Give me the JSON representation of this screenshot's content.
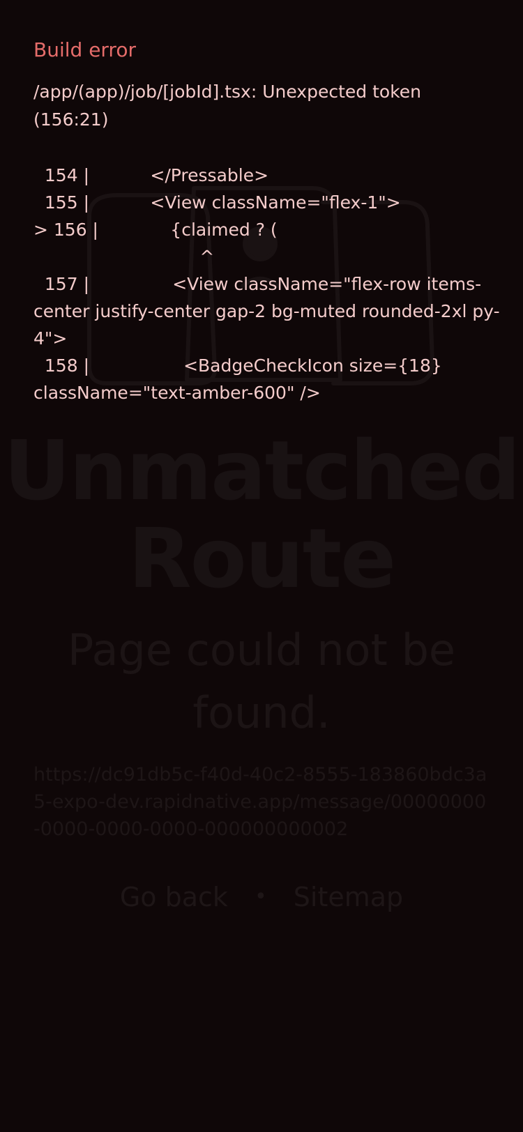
{
  "background": {
    "title": "Unmatched Route",
    "subtitle": "Page could not be found.",
    "url": "https://dc91db5c-f40d-40c2-8555-183860bdc3a5-expo-dev.rapidnative.app/message/00000000-0000-0000-0000-000000000002",
    "links": {
      "go_back": "Go back",
      "separator": "•",
      "sitemap": "Sitemap"
    },
    "icon": "route-illustration-icon"
  },
  "error": {
    "title": "Build error",
    "message": "/app/(app)/job/[jobId].tsx: Unexpected token (156:21)",
    "code_frame": [
      "  154 |           </Pressable>",
      "  155 |           <View className=\"flex-1\">",
      "> 156 |             {claimed ? (",
      "                              ^",
      "  157 |               <View className=\"flex-row items-center justify-center gap-2 bg-muted rounded-2xl py-4\">",
      "  158 |                 <BadgeCheckIcon size={18} className=\"text-amber-600\" />"
    ]
  },
  "colors": {
    "background": "#0f0708",
    "error_title": "#e56c6a",
    "error_text": "#f4cccb",
    "ghost_text": "#1c1415"
  }
}
